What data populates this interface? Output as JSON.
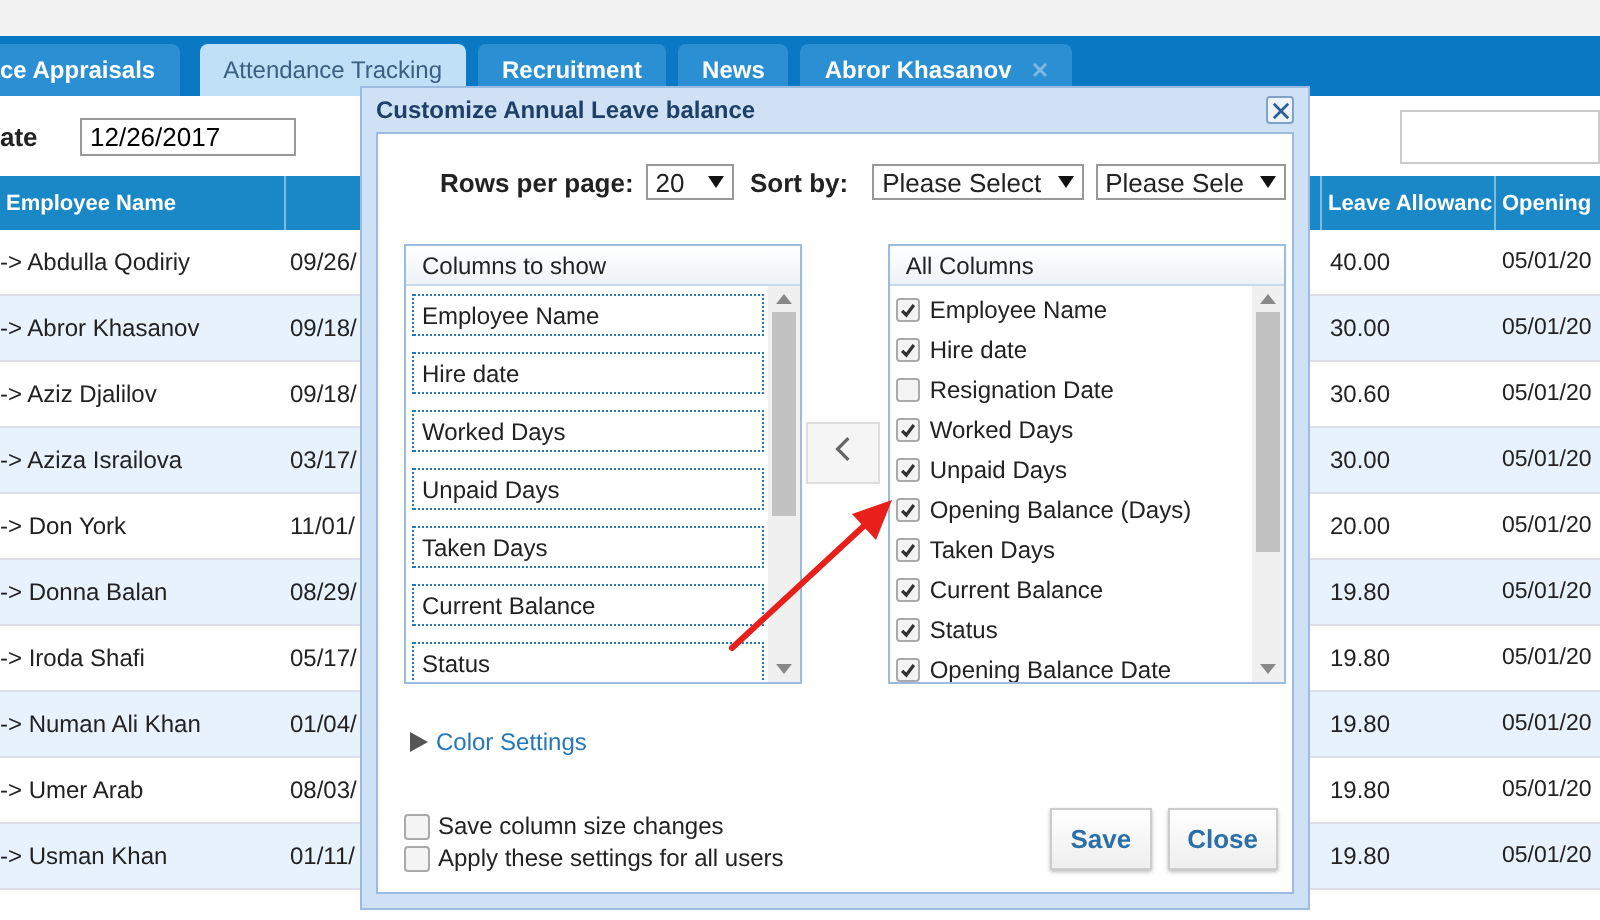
{
  "tabs": [
    {
      "label": "ce Appraisals",
      "selected": false,
      "closable": false
    },
    {
      "label": "Attendance Tracking",
      "selected": true,
      "closable": false
    },
    {
      "label": "Recruitment",
      "selected": false,
      "closable": false
    },
    {
      "label": "News",
      "selected": false,
      "closable": false
    },
    {
      "label": "Abror Khasanov",
      "selected": false,
      "closable": true
    }
  ],
  "filter": {
    "label": "ate",
    "date_value": "12/26/2017"
  },
  "table": {
    "columns": [
      "Employee Name",
      "Leave Allowanc",
      "Opening"
    ],
    "rows": [
      {
        "name": "-> Abdulla Qodiriy",
        "hire_date": "09/26/",
        "allowance": "40.00",
        "opening": "05/01/20"
      },
      {
        "name": "-> Abror Khasanov",
        "hire_date": "09/18/",
        "allowance": "30.00",
        "opening": "05/01/20"
      },
      {
        "name": "-> Aziz Djalilov",
        "hire_date": "09/18/",
        "allowance": "30.60",
        "opening": "05/01/20"
      },
      {
        "name": "-> Aziza Israilova",
        "hire_date": "03/17/",
        "allowance": "30.00",
        "opening": "05/01/20"
      },
      {
        "name": "-> Don York",
        "hire_date": "11/01/",
        "allowance": "20.00",
        "opening": "05/01/20"
      },
      {
        "name": "-> Donna Balan",
        "hire_date": "08/29/",
        "allowance": "19.80",
        "opening": "05/01/20"
      },
      {
        "name": "-> Iroda Shafi",
        "hire_date": "05/17/",
        "allowance": "19.80",
        "opening": "05/01/20"
      },
      {
        "name": "-> Numan Ali Khan",
        "hire_date": "01/04/",
        "allowance": "19.80",
        "opening": "05/01/20"
      },
      {
        "name": "-> Umer Arab",
        "hire_date": "08/03/",
        "allowance": "19.80",
        "opening": "05/01/20"
      },
      {
        "name": "-> Usman Khan",
        "hire_date": "01/11/",
        "allowance": "19.80",
        "opening": "05/01/20"
      }
    ]
  },
  "dialog": {
    "title": "Customize Annual Leave balance",
    "rows_per_page": {
      "label": "Rows per page:",
      "value": "20"
    },
    "sort_by": {
      "label": "Sort by:",
      "selects": [
        "Please Select",
        "Please Sele"
      ]
    },
    "columns_to_show": {
      "title": "Columns to show",
      "items": [
        "Employee Name",
        "Hire date",
        "Worked Days",
        "Unpaid Days",
        "Taken Days",
        "Current Balance",
        "Status"
      ]
    },
    "all_columns": {
      "title": "All Columns",
      "items": [
        {
          "label": "Employee Name",
          "checked": true
        },
        {
          "label": "Hire date",
          "checked": true
        },
        {
          "label": "Resignation Date",
          "checked": false
        },
        {
          "label": "Worked Days",
          "checked": true
        },
        {
          "label": "Unpaid Days",
          "checked": true
        },
        {
          "label": "Opening Balance (Days)",
          "checked": true
        },
        {
          "label": "Taken Days",
          "checked": true
        },
        {
          "label": "Current Balance",
          "checked": true
        },
        {
          "label": "Status",
          "checked": true
        },
        {
          "label": "Opening Balance Date",
          "checked": true
        }
      ]
    },
    "color_settings": "Color Settings",
    "options": [
      {
        "label": "Save column size changes",
        "checked": false
      },
      {
        "label": "Apply these settings for all users",
        "checked": false
      }
    ],
    "buttons": [
      "Save",
      "Close"
    ]
  }
}
